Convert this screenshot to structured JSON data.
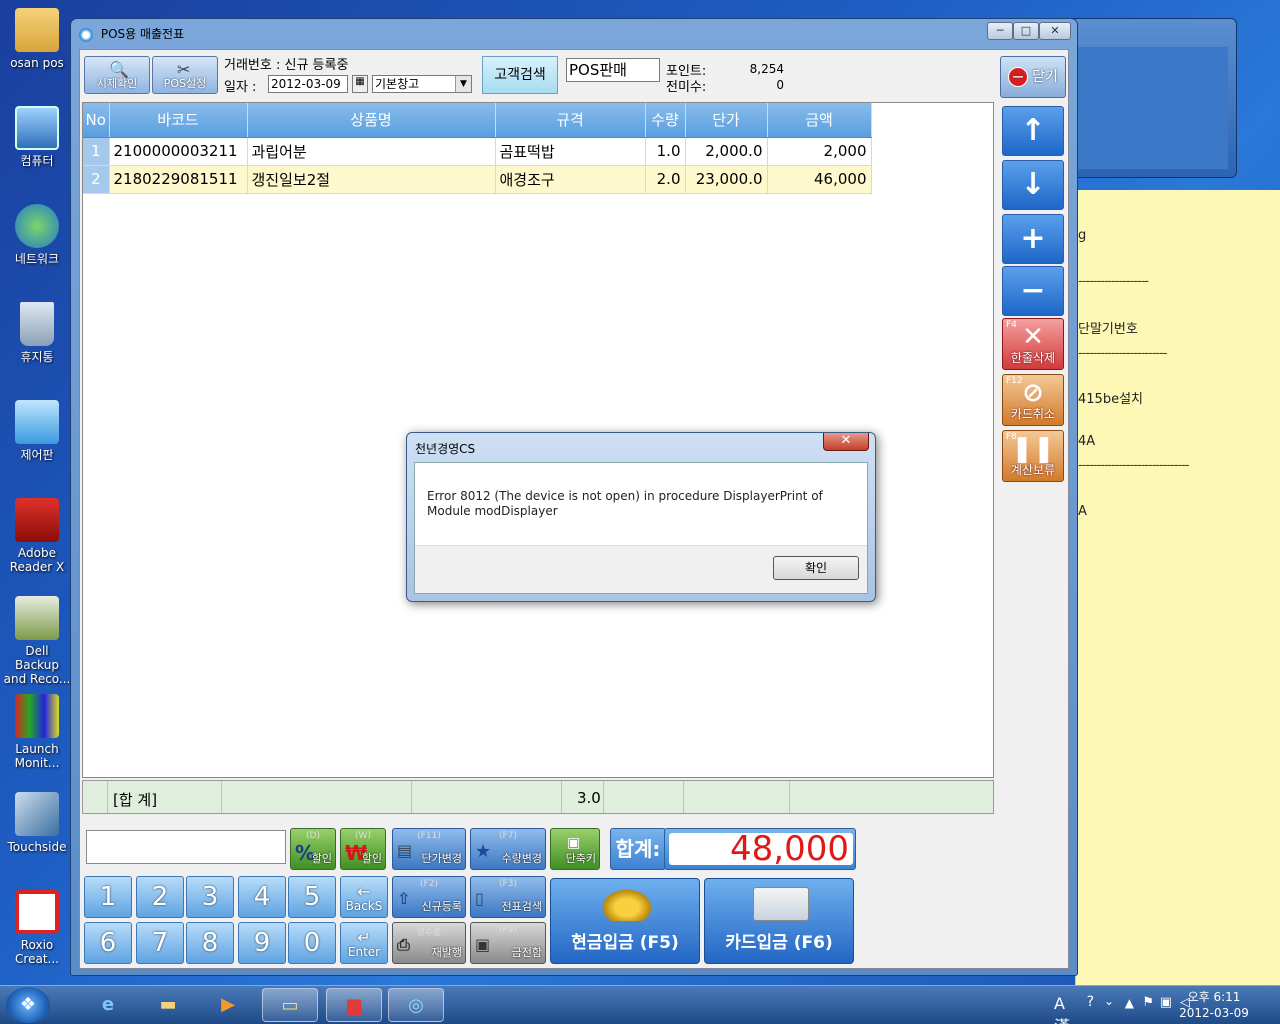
{
  "desktop": {
    "icons": [
      {
        "label": "osan pos"
      },
      {
        "label": "컴퓨터"
      },
      {
        "label": "네트워크"
      },
      {
        "label": "휴지통"
      },
      {
        "label": "제어판"
      },
      {
        "label": "Adobe Reader X"
      },
      {
        "label": "Dell Backup and Reco..."
      },
      {
        "label": "Launch Monit..."
      },
      {
        "label": "Touchside"
      },
      {
        "label": "Roxio Creat..."
      }
    ]
  },
  "note": {
    "lines": [
      "g",
      "-------------------",
      "단말기번호",
      "------------------------",
      "415be설치",
      "4A",
      "------------------------------",
      "A"
    ]
  },
  "window": {
    "title": "POS용 매출전표",
    "min": "─",
    "max": "□",
    "close": "✕"
  },
  "toolbar": {
    "btn_time": "시제확인",
    "btn_setting": "POS설정",
    "trade_no_label": "거래번호 : 신규 등록중",
    "date_label": "일자 :",
    "date_value": "2012-03-09",
    "warehouse": "기본창고",
    "customer_search": "고객검색",
    "pos_sale": "POS판매",
    "point_label": "포인트:",
    "point_value": "8,254",
    "unpaid_label": "전미수:",
    "unpaid_value": "0",
    "close": "닫기"
  },
  "grid": {
    "headers": [
      "No",
      "바코드",
      "상품명",
      "규격",
      "수량",
      "단가",
      "금액"
    ],
    "rows": [
      {
        "no": "1",
        "barcode": "2100000003211",
        "name": "과립어분",
        "spec": "곰표떡밥",
        "qty": "1.0",
        "price": "2,000.0",
        "amount": "2,000"
      },
      {
        "no": "2",
        "barcode": "2180229081511",
        "name": "갱진일보2절",
        "spec": "애경조구",
        "qty": "2.0",
        "price": "23,000.0",
        "amount": "46,000"
      }
    ],
    "total_label": "[합 계]",
    "total_qty": "3.0"
  },
  "side": {
    "delete_key": "F4",
    "delete_label": "한줄삭제",
    "card_cancel_key": "F12",
    "card_cancel_label": "카드취소",
    "hold_key": "F8",
    "hold_label": "계산보류"
  },
  "bottom": {
    "discount_pct_key": "(D)",
    "discount_pct": "할인",
    "discount_won_key": "(W)",
    "discount_won": "할인",
    "price_change_key": "(F11)",
    "price_change": "단가변경",
    "qty_change_key": "(F7)",
    "qty_change": "수량변경",
    "shortcut": "단축키",
    "sum_label": "합계:",
    "sum_value": "48,000",
    "new_key": "(F2)",
    "new_reg": "신규등록",
    "slip_key": "(F3)",
    "slip_search": "전표검색",
    "receipt_key": "영수증",
    "receipt": "재발행",
    "drawer_key": "(F9)",
    "drawer": "금전함",
    "backspace": "BackS",
    "enter": "Enter",
    "cash": "현금입금 (F5)",
    "card": "카드입금 (F6)",
    "keys": [
      "1",
      "2",
      "3",
      "4",
      "5",
      "6",
      "7",
      "8",
      "9",
      "0"
    ]
  },
  "dialog": {
    "title": "천년경영CS",
    "message": "Error 8012 (The device is not open) in procedure DisplayerPrint of Module modDisplayer",
    "ok": "확인",
    "close": "✕"
  },
  "taskbar": {
    "lang": "A漢",
    "time": "오후 6:11",
    "date": "2012-03-09"
  }
}
